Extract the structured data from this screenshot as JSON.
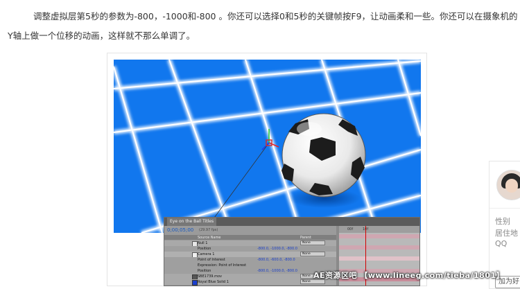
{
  "article": {
    "line1": "调整虚拟层第5秒的参数为-800，-1000和-800 。你还可以选择0和5秒的关键帧按F9，让动画柔和一些。你还可以在摄象机的",
    "line2": "Y轴上做一个位移的动画，这样就不那么单调了。"
  },
  "ae_panel": {
    "tab_title": "Eye on the Ball Titles",
    "timecode": "0;00;05;00",
    "fps": "(29.97 fps)",
    "col_source": "Source Name",
    "col_parent": "Parent",
    "layers": [
      {
        "num": "1",
        "name": "Null 1",
        "value": "",
        "parent": "None"
      },
      {
        "num": "2",
        "name": "Position",
        "value": "-800.0, -1000.0, -800.0",
        "parent": ""
      },
      {
        "num": "3",
        "name": "Camera 1",
        "value": "",
        "parent": "None"
      },
      {
        "num": "",
        "name": "Point of Interest",
        "value": "-800.0, -600.0, -800.0",
        "parent": ""
      },
      {
        "num": "",
        "name": "Expression: Point of Interest",
        "value": "",
        "parent": ""
      },
      {
        "num": "",
        "name": "Position",
        "value": "-800.0, -1000.0, -800.0",
        "parent": ""
      },
      {
        "num": "4",
        "name": "SBE1739.mov",
        "value": "",
        "parent": "None"
      },
      {
        "num": "5",
        "name": "Royal Blue Solid 1",
        "value": "",
        "parent": "None"
      }
    ],
    "ruler_labels": [
      "00f",
      "10f"
    ]
  },
  "profile_card": {
    "gender_label": "性别",
    "location_label": "居住地",
    "qq_label": "QQ",
    "add_friend_label": "加为好"
  },
  "watermark": "AE资源区吧 【www.lineeg.com/tieba/1801】",
  "colors": {
    "scene_blue": "#1177ee",
    "grid_glow": "#ffffff",
    "timecode_blue": "#1558c0"
  }
}
